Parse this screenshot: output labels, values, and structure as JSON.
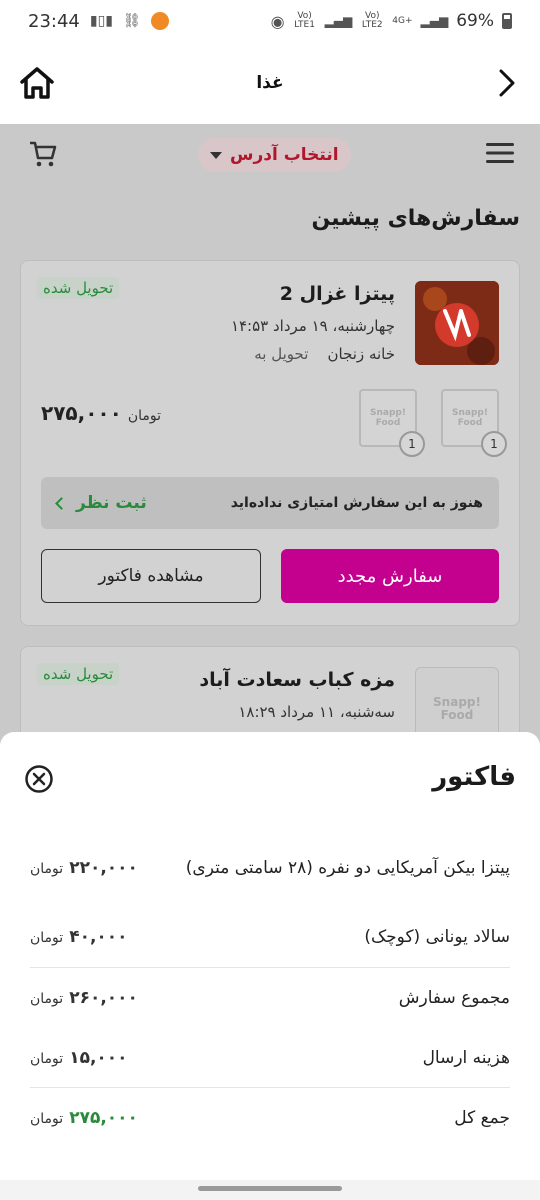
{
  "status_bar": {
    "time": "23:44",
    "battery": "69%",
    "sim1": "Vo) LTE1",
    "sim2": "Vo) LTE2",
    "network": "4G+"
  },
  "app_header": {
    "title": "غذا"
  },
  "top_nav": {
    "address_label": "انتخاب آدرس"
  },
  "section": {
    "title": "سفارش‌های پیشین"
  },
  "orders": [
    {
      "restaurant": "پیتزا غزال 2",
      "datetime": "چهارشنبه، ۱۹ مرداد   ۱۴:۵۳",
      "delivery_prefix": "تحویل به",
      "delivery_place": "خانه زنجان",
      "status": "تحویل شده",
      "price": "۲۷۵,۰۰۰",
      "price_unit": "تومان",
      "items": [
        {
          "logo": "Snapp! Food",
          "qty": "1"
        },
        {
          "logo": "Snapp! Food",
          "qty": "1"
        }
      ],
      "rating_message": "هنوز به این سفارش امتیازی نداده‌اید",
      "rating_action": "ثبت نظر",
      "reorder_label": "سفارش مجدد",
      "invoice_label": "مشاهده فاکتور",
      "thumb_text": "پیتزا غزال"
    },
    {
      "restaurant": "مزه کباب سعادت آباد",
      "datetime": "سه‌شنبه، ۱۱ مرداد   ۱۸:۲۹",
      "status": "تحویل شده",
      "thumb_text": "Snapp! Food"
    }
  ],
  "invoice_sheet": {
    "title": "فاکتور",
    "rows": [
      {
        "label": "پیتزا بیکن آمریکایی دو نفره (۲۸ سامتی متری)",
        "value": "۲۲۰,۰۰۰",
        "unit": "تومان"
      },
      {
        "label": "سالاد یونانی (کوچک)",
        "value": "۴۰,۰۰۰",
        "unit": "تومان"
      },
      {
        "label": "مجموع سفارش",
        "value": "۲۶۰,۰۰۰",
        "unit": "تومان"
      },
      {
        "label": "هزینه ارسال",
        "value": "۱۵,۰۰۰",
        "unit": "تومان"
      },
      {
        "label": "جمع کل",
        "value": "۲۷۵,۰۰۰",
        "unit": "تومان"
      }
    ]
  },
  "colors": {
    "brand_pink": "#c4008e",
    "status_green": "#2a8a3c",
    "address_red": "#b0162c"
  }
}
